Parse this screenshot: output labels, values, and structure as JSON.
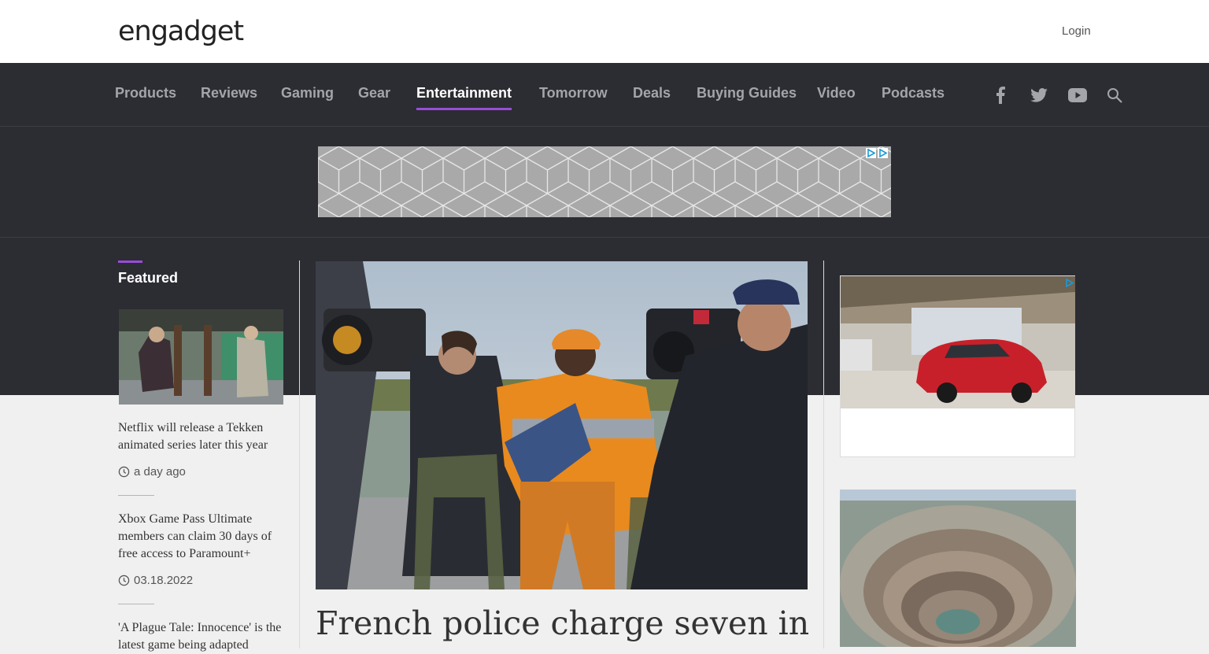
{
  "header": {
    "logo_text": "engadget",
    "login_label": "Login"
  },
  "nav": {
    "items": [
      {
        "label": "Products"
      },
      {
        "label": "Reviews"
      },
      {
        "label": "Gaming"
      },
      {
        "label": "Gear"
      },
      {
        "label": "Entertainment"
      },
      {
        "label": "Tomorrow"
      },
      {
        "label": "Deals"
      },
      {
        "label": "Buying Guides"
      },
      {
        "label": "Video"
      },
      {
        "label": "Podcasts"
      }
    ],
    "active": "Entertainment",
    "social_icons": [
      "facebook-icon",
      "twitter-icon",
      "youtube-icon",
      "search-icon"
    ]
  },
  "featured": {
    "label": "Featured",
    "items": [
      {
        "title": "Netflix will release a Tekken animated series later this year",
        "time": "a day ago"
      },
      {
        "title": "Xbox Game Pass Ultimate members can claim 30 days of free access to Paramount+",
        "time": "03.18.2022"
      },
      {
        "title": "'A Plague Tale: Innocence' is the latest game being adapted",
        "time": ""
      }
    ]
  },
  "main": {
    "headline": "French police charge seven in"
  },
  "colors": {
    "accent": "#9a4bd9",
    "nav_bg": "#2c2d33",
    "page_bg": "#f0f0f0"
  }
}
